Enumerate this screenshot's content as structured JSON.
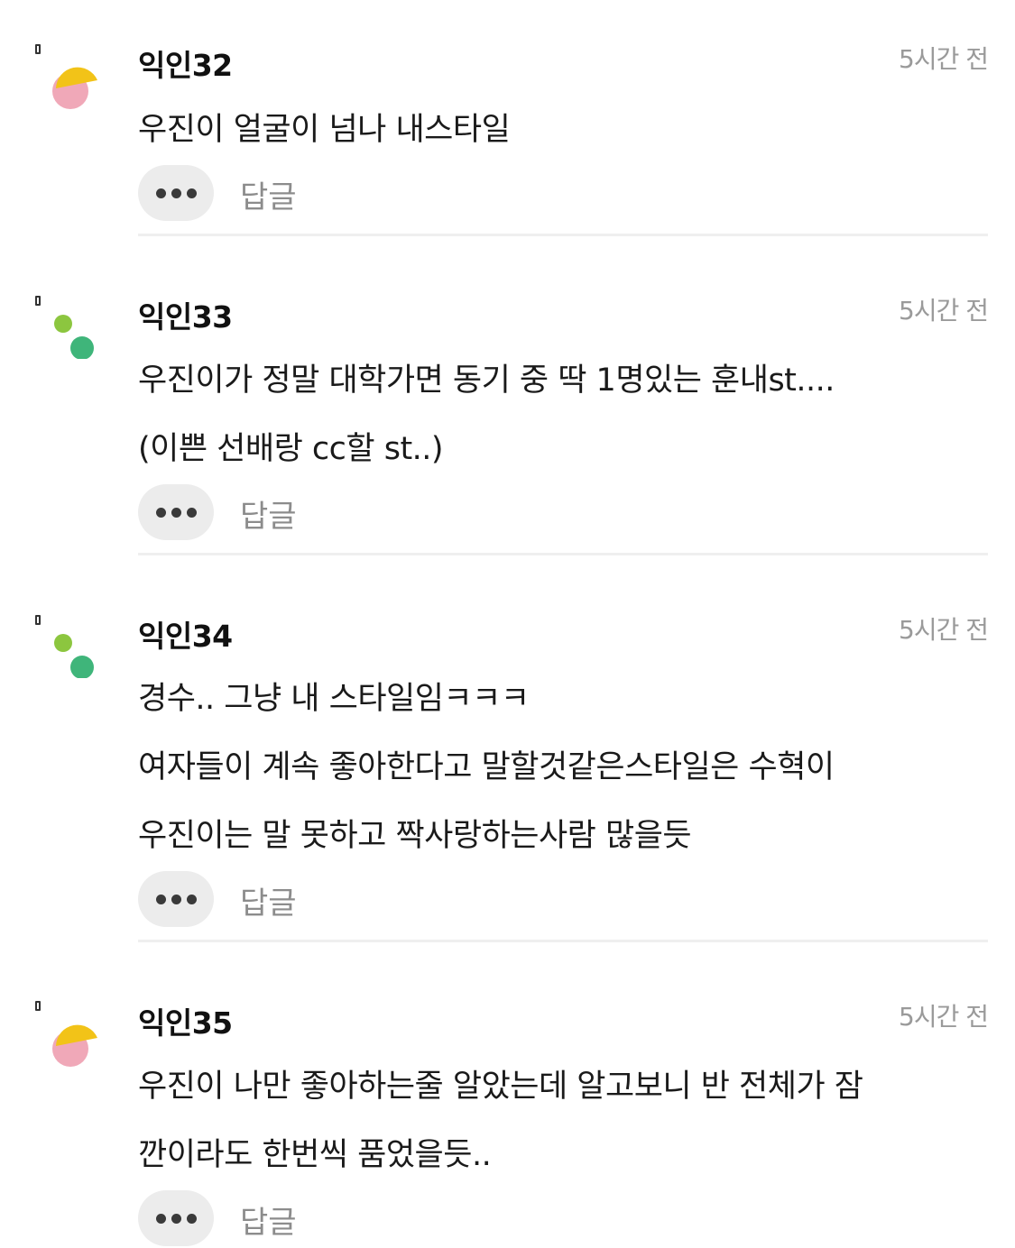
{
  "comments": [
    {
      "author": "익인32",
      "time": "5시간 전",
      "avatar": "sun-avatar-icon",
      "lines": [
        "우진이 얼굴이 넘나 내스타일"
      ],
      "reply_label": "답글",
      "more_icon": "more-dots-icon"
    },
    {
      "author": "익인33",
      "time": "5시간 전",
      "avatar": "dots-avatar-icon",
      "lines": [
        "우진이가 정말 대학가면 동기 중 딱 1명있는 훈내st....",
        "(이쁜 선배랑 cc할 st..)"
      ],
      "reply_label": "답글",
      "more_icon": "more-dots-icon"
    },
    {
      "author": "익인34",
      "time": "5시간 전",
      "avatar": "dots-avatar-icon",
      "lines": [
        "경수.. 그냥 내 스타일임ㅋㅋㅋ",
        "여자들이 계속 좋아한다고 말할것같은스타일은 수혁이",
        "우진이는 말 못하고 짝사랑하는사람 많을듯"
      ],
      "reply_label": "답글",
      "more_icon": "more-dots-icon"
    },
    {
      "author": "익인35",
      "time": "5시간 전",
      "avatar": "sun-avatar-icon",
      "lines": [
        "우진이 나만 좋아하는줄 알았는데 알고보니 반 전체가 잠",
        "깐이라도 한번씩 품었을듯.."
      ],
      "reply_label": "답글",
      "more_icon": "more-dots-icon"
    }
  ],
  "colors": {
    "avatar_yellow": "#f2c318",
    "avatar_pink": "#f0a8b8",
    "avatar_lightgreen": "#8cc63f",
    "avatar_green": "#3fb57a",
    "time_gray": "#9a9a9a",
    "button_bg": "#ececec"
  }
}
